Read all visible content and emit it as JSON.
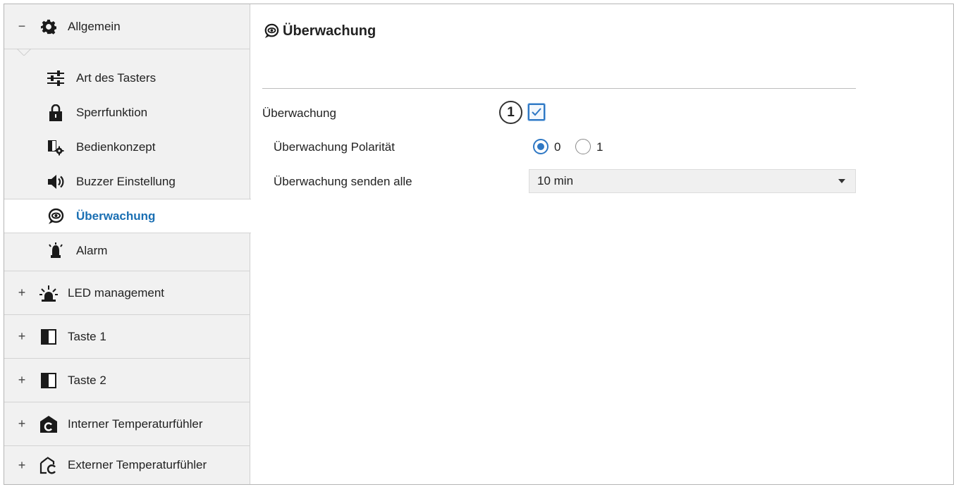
{
  "sidebar": {
    "groups": [
      {
        "sign": "−",
        "icon": "gear-icon",
        "label": "Allgemein"
      },
      {
        "sign": "+",
        "icon": "led-icon",
        "label": "LED management"
      },
      {
        "sign": "+",
        "icon": "button-panel-icon",
        "label": "Taste 1"
      },
      {
        "sign": "+",
        "icon": "button-panel-icon",
        "label": "Taste 2"
      },
      {
        "sign": "+",
        "icon": "internal-sensor-icon",
        "label": "Interner Temperaturfühler"
      },
      {
        "sign": "+",
        "icon": "external-sensor-icon",
        "label": "Externer Temperaturfühler"
      }
    ],
    "items": [
      {
        "icon": "sliders-icon",
        "label": "Art des Tasters"
      },
      {
        "icon": "lock-icon",
        "label": "Sperrfunktion"
      },
      {
        "icon": "operation-concept-icon",
        "label": "Bedienkonzept"
      },
      {
        "icon": "speaker-icon",
        "label": "Buzzer Einstellung"
      },
      {
        "icon": "monitoring-icon",
        "label": "Überwachung",
        "active": true
      },
      {
        "icon": "alarm-icon",
        "label": "Alarm"
      }
    ]
  },
  "main": {
    "title": "Überwachung",
    "title_icon": "monitoring-icon",
    "marker": "1",
    "rows": {
      "monitoring_label": "Überwachung",
      "monitoring_checked": true,
      "polarity_label": "Überwachung Polarität",
      "polarity_options": [
        "0",
        "1"
      ],
      "polarity_selected": "0",
      "send_label": "Überwachung senden alle",
      "send_value": "10 min"
    }
  },
  "colors": {
    "accent": "#1a6fb3",
    "control_blue": "#2f78c4",
    "sidebar_bg": "#f1f1f1"
  }
}
